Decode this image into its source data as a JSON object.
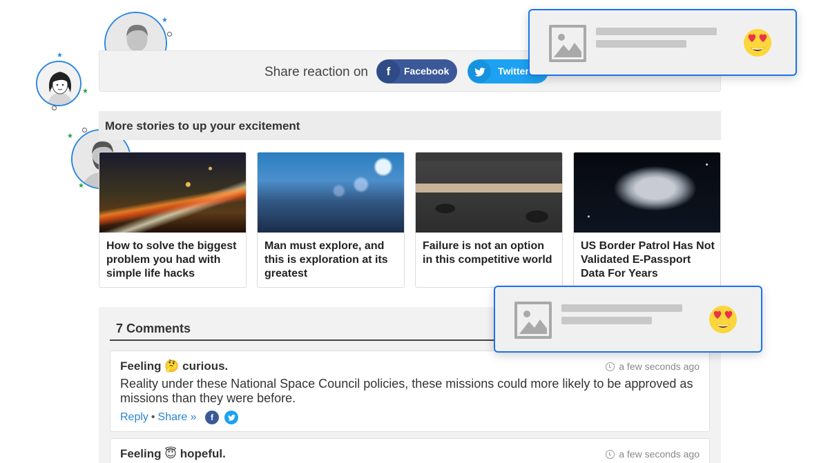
{
  "share": {
    "label": "Share reaction on",
    "facebook_label": "Facebook",
    "facebook_icon": "f",
    "twitter_label": "Twitter",
    "colors": {
      "facebook": "#3b5998",
      "twitter": "#1da1f2"
    }
  },
  "stories": {
    "heading": "More stories to up your excitement",
    "items": [
      {
        "title": "How to solve the biggest problem you had with simple life hacks"
      },
      {
        "title": "Man must explore, and this is exploration at its greatest"
      },
      {
        "title": "Failure is not an option in this competitive world"
      },
      {
        "title": "US Border Patrol Has Not Validated E-Passport Data For Years"
      }
    ]
  },
  "comments": {
    "heading": "7 Comments",
    "items": [
      {
        "feeling_prefix": "Feeling",
        "emoji": "🤔",
        "feeling": "curious.",
        "time": "a few seconds ago",
        "body": "Reality under these National Space Council policies, these missions could more likely to be approved as missions than they were before.",
        "reply": "Reply",
        "share": "Share »"
      },
      {
        "feeling_prefix": "Feeling",
        "emoji": "😇",
        "feeling": "hopeful.",
        "time": "a few seconds ago"
      }
    ]
  },
  "popups": [
    {
      "icon": "image-placeholder-icon",
      "reaction": "heart-eyes-emoji"
    },
    {
      "icon": "image-placeholder-icon",
      "reaction": "heart-eyes-emoji"
    }
  ],
  "accent_color": "#1a73e8"
}
